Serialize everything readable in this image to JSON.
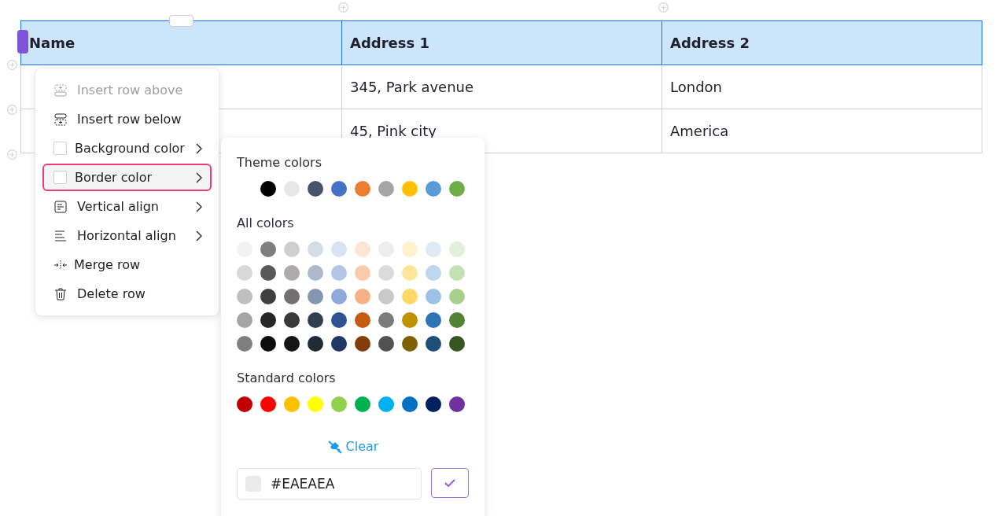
{
  "table": {
    "columns": [
      "Name",
      "Address 1",
      "Address 2"
    ],
    "rows": [
      {
        "address_1": "345, Park avenue",
        "address_2": "London"
      },
      {
        "address_1": "45, Pink city",
        "address_2": "America"
      }
    ]
  },
  "context_menu": {
    "items": [
      {
        "kind": "insert-above",
        "label": "Insert row above",
        "disabled": true,
        "submenu": false,
        "selected": false
      },
      {
        "kind": "insert-below",
        "label": "Insert row below",
        "disabled": false,
        "submenu": false,
        "selected": false
      },
      {
        "kind": "swatch",
        "label": "Background color",
        "disabled": false,
        "submenu": true,
        "selected": false
      },
      {
        "kind": "swatch",
        "label": "Border color",
        "disabled": false,
        "submenu": true,
        "selected": true
      },
      {
        "kind": "valign",
        "label": "Vertical align",
        "disabled": false,
        "submenu": true,
        "selected": false
      },
      {
        "kind": "halign",
        "label": "Horizontal align",
        "disabled": false,
        "submenu": true,
        "selected": false
      },
      {
        "kind": "merge",
        "label": "Merge row",
        "disabled": false,
        "submenu": false,
        "selected": false
      },
      {
        "kind": "delete",
        "label": "Delete row",
        "disabled": false,
        "submenu": false,
        "selected": false
      }
    ]
  },
  "color_picker": {
    "theme_title": "Theme colors",
    "theme_colors": [
      {
        "color": "#000000"
      },
      {
        "color": "#e7e7e7"
      },
      {
        "color": "#44546a"
      },
      {
        "color": "#4472c4"
      },
      {
        "color": "#ed7d31"
      },
      {
        "color": "#a5a5a5"
      },
      {
        "color": "#ffc000"
      },
      {
        "color": "#5b9bd5"
      },
      {
        "color": "#70ad47"
      }
    ],
    "all_title": "All colors",
    "all_colors": [
      {
        "color": "#f2f2f2"
      },
      {
        "color": "#7f7f7f"
      },
      {
        "color": "#d0cece"
      },
      {
        "color": "#d6dce4"
      },
      {
        "color": "#d9e2f3"
      },
      {
        "color": "#fbe5d5"
      },
      {
        "color": "#ededed"
      },
      {
        "color": "#fff2cc"
      },
      {
        "color": "#deebf6"
      },
      {
        "color": "#e2efd9"
      },
      {
        "color": "#d8d8d8"
      },
      {
        "color": "#595959"
      },
      {
        "color": "#aeabab"
      },
      {
        "color": "#adb9ca"
      },
      {
        "color": "#b4c6e7"
      },
      {
        "color": "#f7cbac"
      },
      {
        "color": "#dbdbdb"
      },
      {
        "color": "#fee599"
      },
      {
        "color": "#bdd7ee"
      },
      {
        "color": "#c5e0b3"
      },
      {
        "color": "#bfbfbf"
      },
      {
        "color": "#3f3f3f"
      },
      {
        "color": "#757070"
      },
      {
        "color": "#8496b0"
      },
      {
        "color": "#8eaadb"
      },
      {
        "color": "#f4b183"
      },
      {
        "color": "#c9c9c9"
      },
      {
        "color": "#ffd965"
      },
      {
        "color": "#9cc3e5"
      },
      {
        "color": "#a8d08d"
      },
      {
        "color": "#a5a5a5"
      },
      {
        "color": "#262626"
      },
      {
        "color": "#3a3838"
      },
      {
        "color": "#323f4f"
      },
      {
        "color": "#2f5496"
      },
      {
        "color": "#c55a11"
      },
      {
        "color": "#7b7b7b"
      },
      {
        "color": "#bf9000"
      },
      {
        "color": "#2e75b5"
      },
      {
        "color": "#538135"
      },
      {
        "color": "#7f7f7f"
      },
      {
        "color": "#0c0c0c"
      },
      {
        "color": "#171616"
      },
      {
        "color": "#222a35"
      },
      {
        "color": "#1f3864"
      },
      {
        "color": "#833c0b"
      },
      {
        "color": "#525252"
      },
      {
        "color": "#7f6000"
      },
      {
        "color": "#1e4e79"
      },
      {
        "color": "#375623"
      }
    ],
    "standard_title": "Standard colors",
    "standard_colors": [
      {
        "color": "#c00000"
      },
      {
        "color": "#ff0000"
      },
      {
        "color": "#ffc000"
      },
      {
        "color": "#ffff00"
      },
      {
        "color": "#92d050"
      },
      {
        "color": "#00b050"
      },
      {
        "color": "#00b0f0"
      },
      {
        "color": "#0070c0"
      },
      {
        "color": "#002060"
      },
      {
        "color": "#7030a0"
      }
    ],
    "clear_label": "Clear",
    "value": "#EAEAEA"
  }
}
